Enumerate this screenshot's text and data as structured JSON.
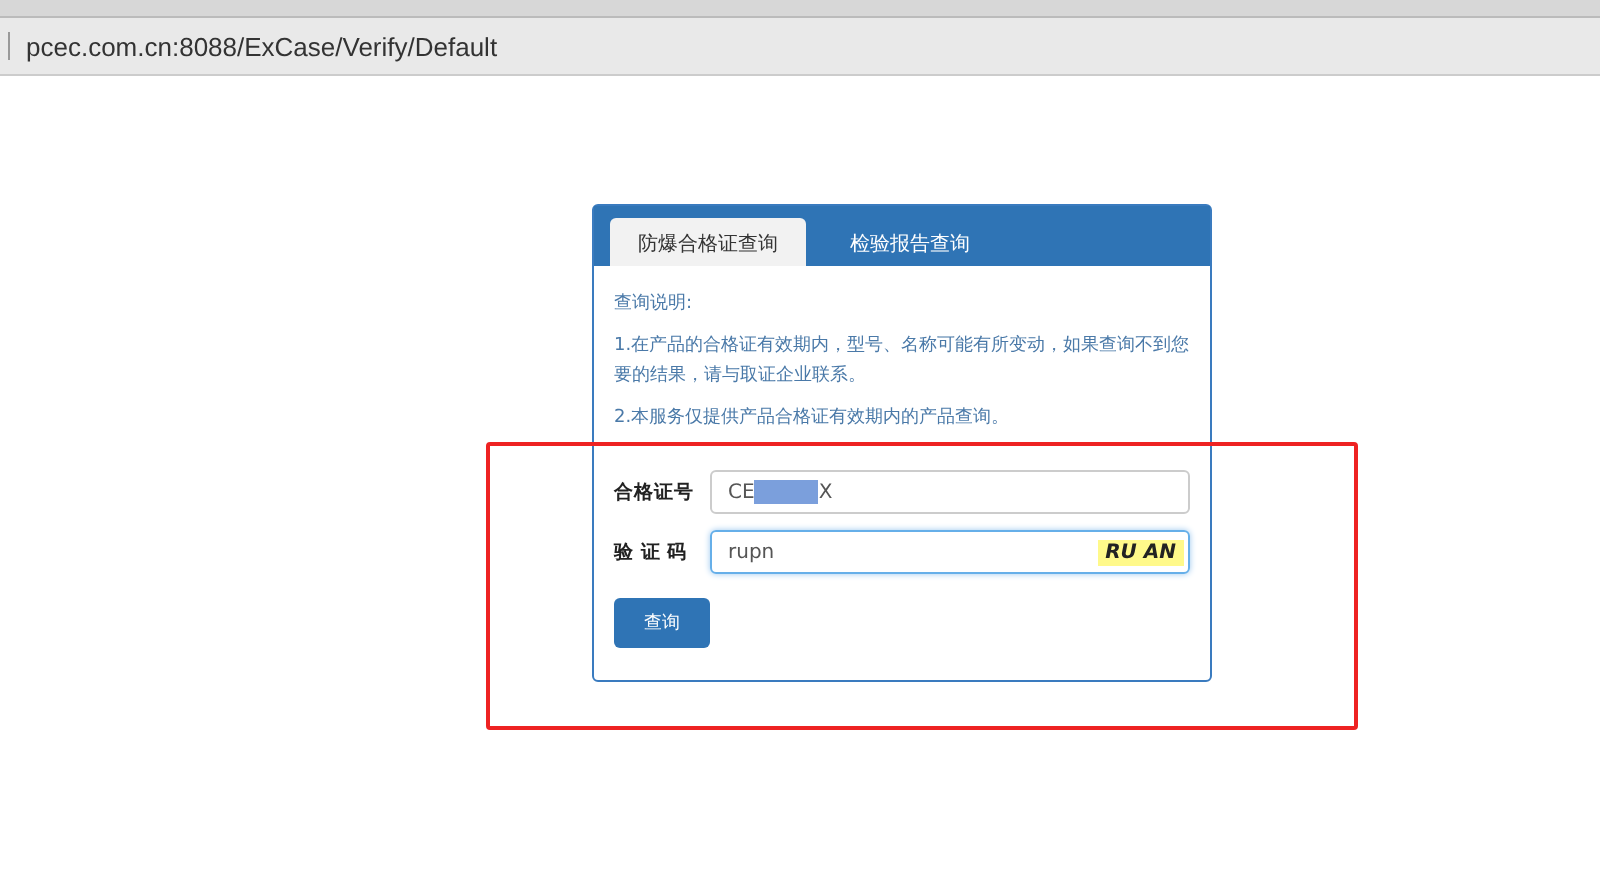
{
  "address_bar": {
    "url": "pcec.com.cn:8088/ExCase/Verify/Default"
  },
  "tabs": [
    {
      "label": "防爆合格证查询",
      "selected": true
    },
    {
      "label": "检验报告查询",
      "selected": false
    }
  ],
  "notes": [
    "查询说明:",
    "1.在产品的合格证有效期内，型号、名称可能有所变动，如果查询不到您要的结果，请与取证企业联系。",
    "2.本服务仅提供产品合格证有效期内的产品查询。"
  ],
  "form": {
    "certificate_label": "合格证号",
    "certificate_value_start": "CE",
    "certificate_value_redacted": true,
    "certificate_value_end": "X",
    "captcha_label": "验 证 码",
    "captcha_value": "rupn",
    "captcha_text": "RU AN",
    "submit": "查询"
  },
  "highlight_box": true
}
